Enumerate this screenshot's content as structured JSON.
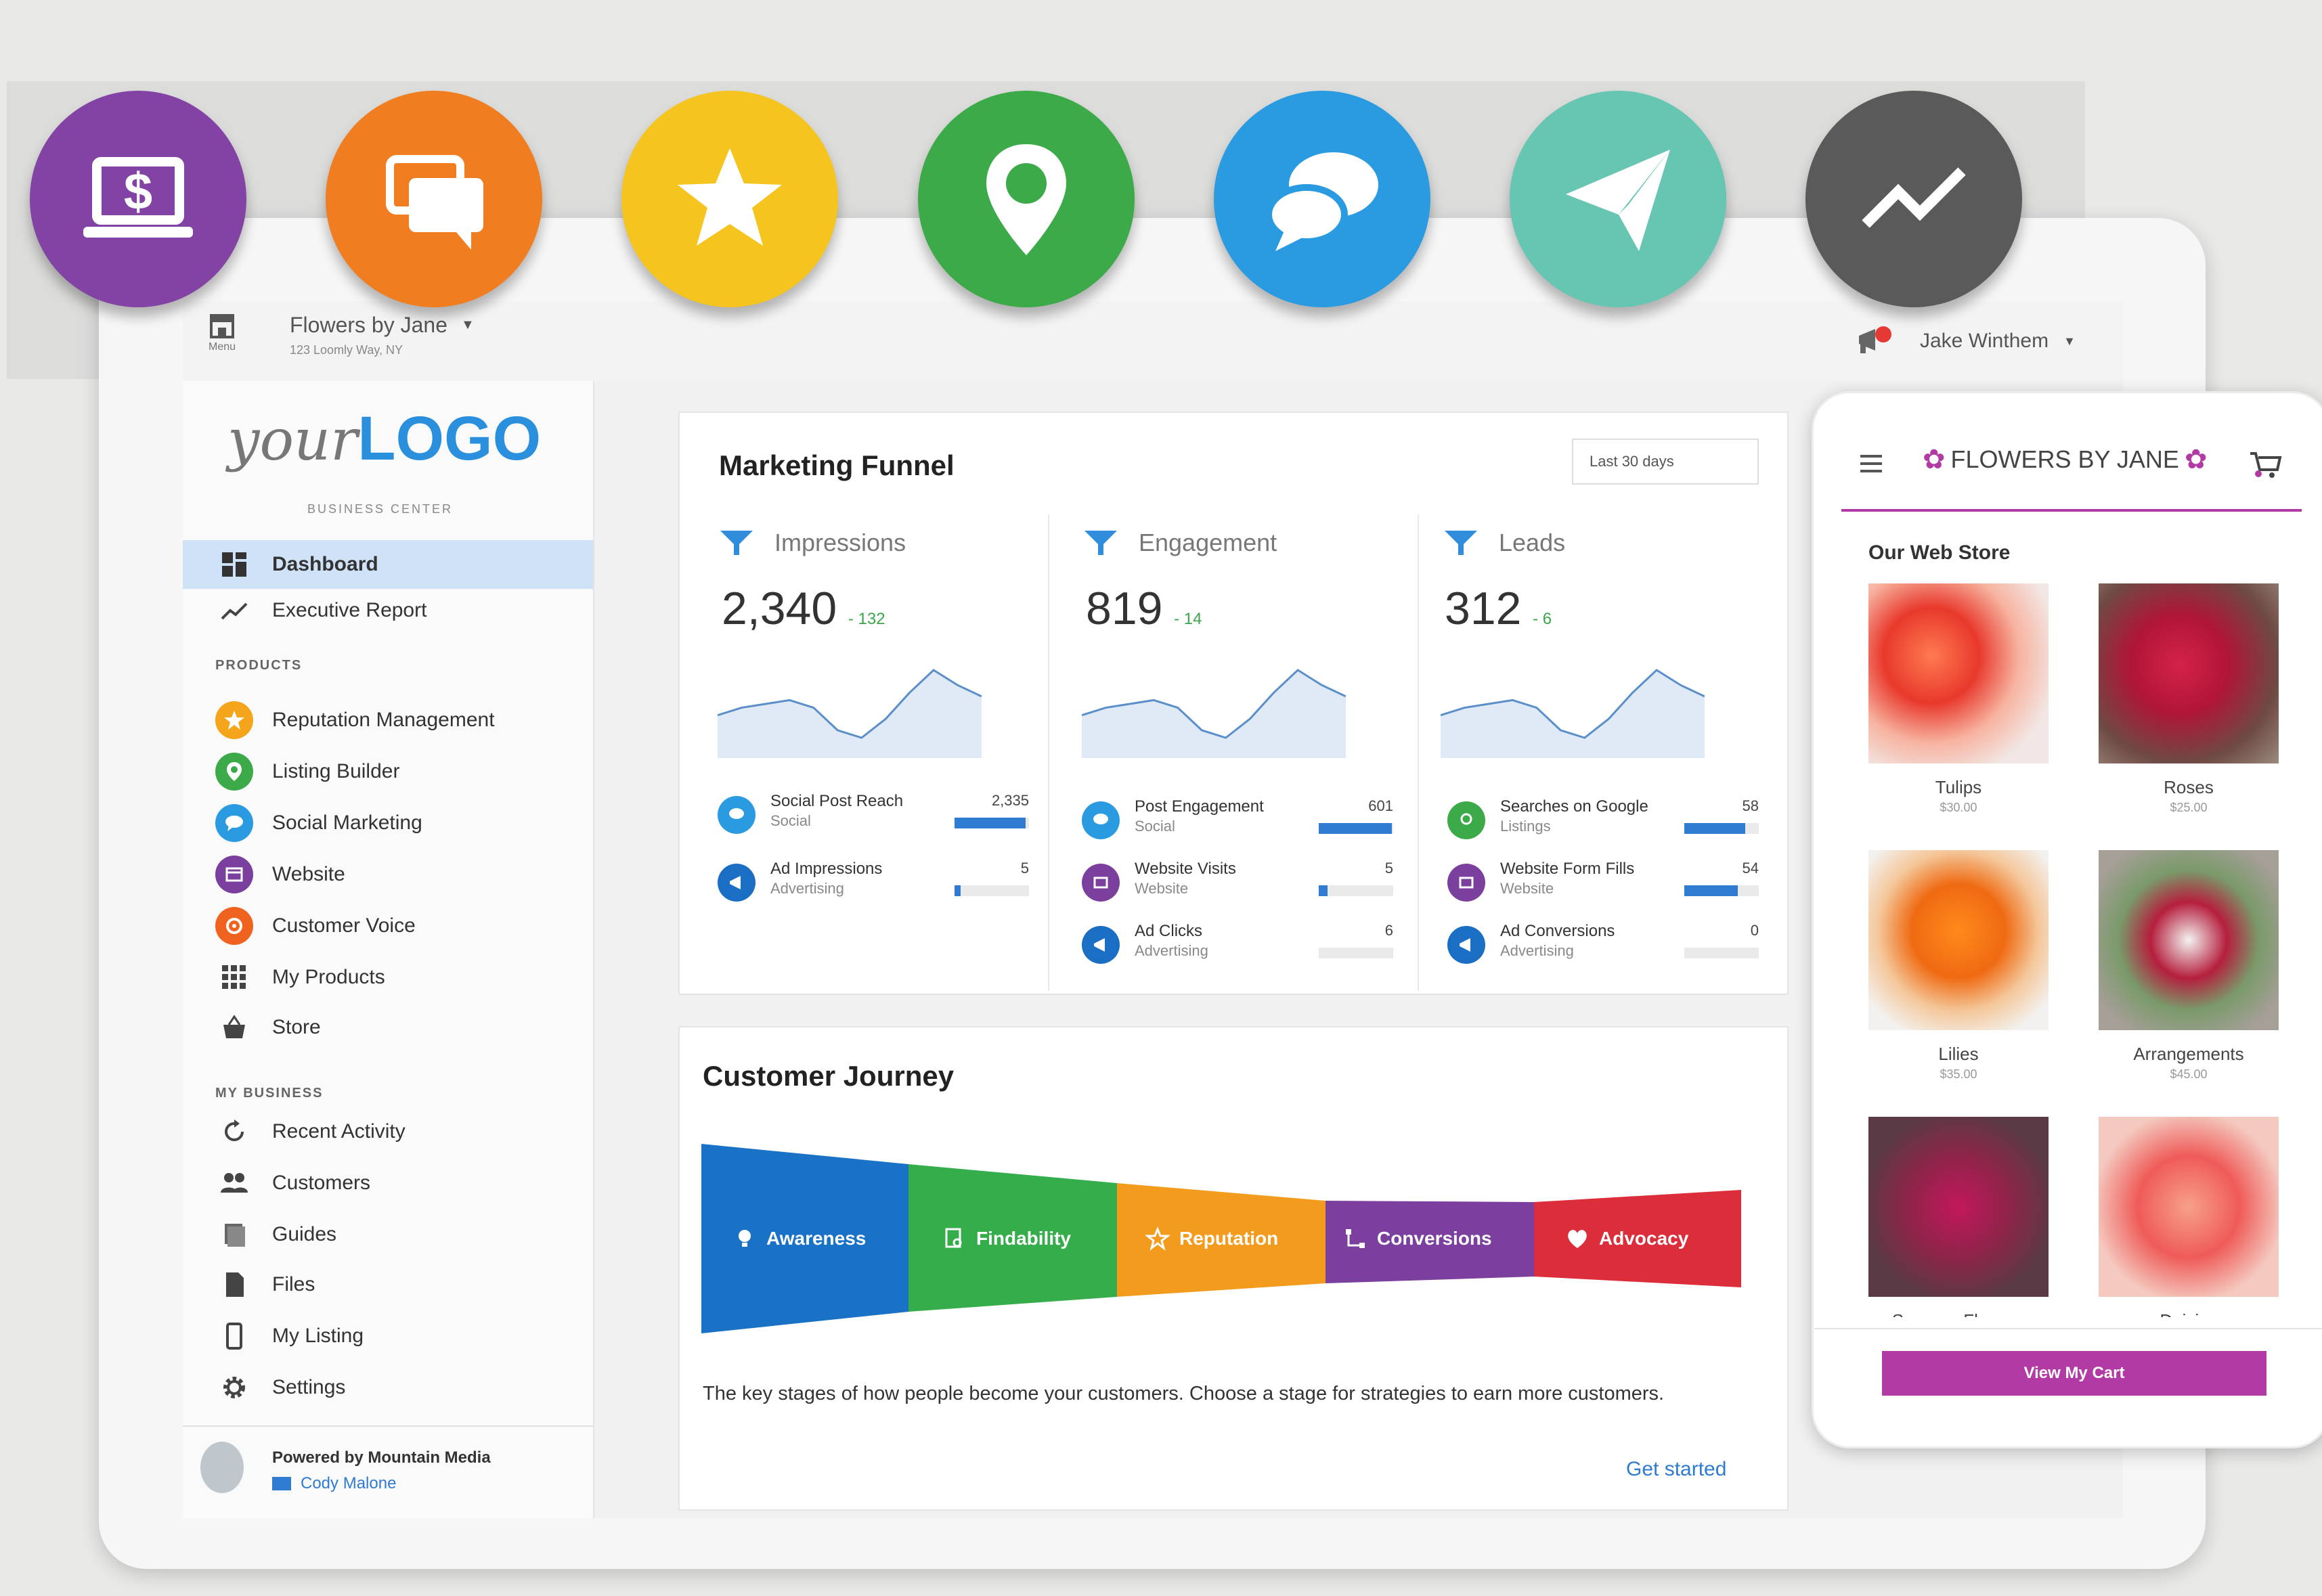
{
  "colors": {
    "billing": "#8343a5",
    "chat": "#f07d20",
    "reputation": "#f6c41e",
    "listing": "#3caa48",
    "social": "#2a9be0",
    "send": "#67c6b1",
    "trend": "#5a5a5a",
    "accent_blue": "#2f7bd2",
    "store_purple": "#b23aa5"
  },
  "feature_icons": [
    "billing-laptop-icon",
    "chat-bubbles-icon",
    "star-icon",
    "map-pin-icon",
    "speech-bubbles-icon",
    "paper-plane-icon",
    "trend-line-icon"
  ],
  "topbar": {
    "menu_label": "Menu",
    "business_name": "Flowers by Jane",
    "business_address": "123 Loomly Way, NY",
    "user_name": "Jake Winthem"
  },
  "sidebar": {
    "logo_script": "your",
    "logo_bold": "LOGO",
    "subtitle": "BUSINESS CENTER",
    "top_items": [
      {
        "label": "Dashboard",
        "selected": true
      },
      {
        "label": "Executive Report"
      }
    ],
    "products_heading": "PRODUCTS",
    "products": [
      {
        "label": "Reputation Management"
      },
      {
        "label": "Listing Builder"
      },
      {
        "label": "Social Marketing"
      },
      {
        "label": "Website"
      },
      {
        "label": "Customer Voice"
      },
      {
        "label": "My Products"
      },
      {
        "label": "Store"
      }
    ],
    "my_business_heading": "MY BUSINESS",
    "my_business": [
      {
        "label": "Recent Activity"
      },
      {
        "label": "Customers"
      },
      {
        "label": "Guides"
      },
      {
        "label": "Files"
      },
      {
        "label": "My Listing"
      },
      {
        "label": "Settings"
      }
    ],
    "powered_by": "Powered by Mountain Media",
    "contact_name": "Cody Malone"
  },
  "funnel": {
    "title": "Marketing Funnel",
    "range": "Last 30 days",
    "columns": [
      {
        "label": "Impressions",
        "value": "2,340",
        "delta": "132",
        "sparkline": [
          10,
          12,
          13,
          14,
          12,
          6,
          4,
          9,
          16,
          22,
          18,
          15
        ],
        "metrics": [
          {
            "title": "Social Post Reach",
            "sub": "Social",
            "value": "2,335",
            "level": 0.95
          },
          {
            "title": "Ad Impressions",
            "sub": "Advertising",
            "value": "5",
            "level": 0.08
          }
        ]
      },
      {
        "label": "Engagement",
        "value": "819",
        "delta": "14",
        "sparkline": [
          10,
          12,
          13,
          14,
          12,
          6,
          4,
          9,
          16,
          22,
          18,
          15
        ],
        "metrics": [
          {
            "title": "Post Engagement",
            "sub": "Social",
            "value": "601",
            "level": 0.98
          },
          {
            "title": "Website Visits",
            "sub": "Website",
            "value": "5",
            "level": 0.12
          },
          {
            "title": "Ad Clicks",
            "sub": "Advertising",
            "value": "6",
            "level": 0
          }
        ]
      },
      {
        "label": "Leads",
        "value": "312",
        "delta": "6",
        "sparkline": [
          10,
          12,
          13,
          14,
          12,
          6,
          4,
          9,
          16,
          22,
          18,
          15
        ],
        "metrics": [
          {
            "title": "Searches on Google",
            "sub": "Listings",
            "value": "58",
            "level": 0.82
          },
          {
            "title": "Website Form Fills",
            "sub": "Website",
            "value": "54",
            "level": 0.72
          },
          {
            "title": "Ad Conversions",
            "sub": "Advertising",
            "value": "0",
            "level": 0
          }
        ]
      }
    ]
  },
  "journey": {
    "title": "Customer Journey",
    "stages": [
      {
        "label": "Awareness",
        "color": "#1a72c7"
      },
      {
        "label": "Findability",
        "color": "#35ad4a"
      },
      {
        "label": "Reputation",
        "color": "#f29b1c"
      },
      {
        "label": "Conversions",
        "color": "#7b3f9e"
      },
      {
        "label": "Advocacy",
        "color": "#dc2d3a"
      }
    ],
    "description": "The key stages of how people become your customers. Choose a stage for strategies to earn more customers.",
    "cta": "Get started"
  },
  "phone": {
    "store_name": "FLOWERS BY JANE",
    "section_title": "Our Web Store",
    "products": [
      {
        "name": "Tulips",
        "price": "$30.00"
      },
      {
        "name": "Roses",
        "price": "$25.00"
      },
      {
        "name": "Lilies",
        "price": "$35.00"
      },
      {
        "name": "Arrangements",
        "price": "$45.00"
      },
      {
        "name": "Summer Flowers",
        "price": ""
      },
      {
        "name": "Daisies",
        "price": ""
      }
    ],
    "cart_button": "View My Cart"
  }
}
